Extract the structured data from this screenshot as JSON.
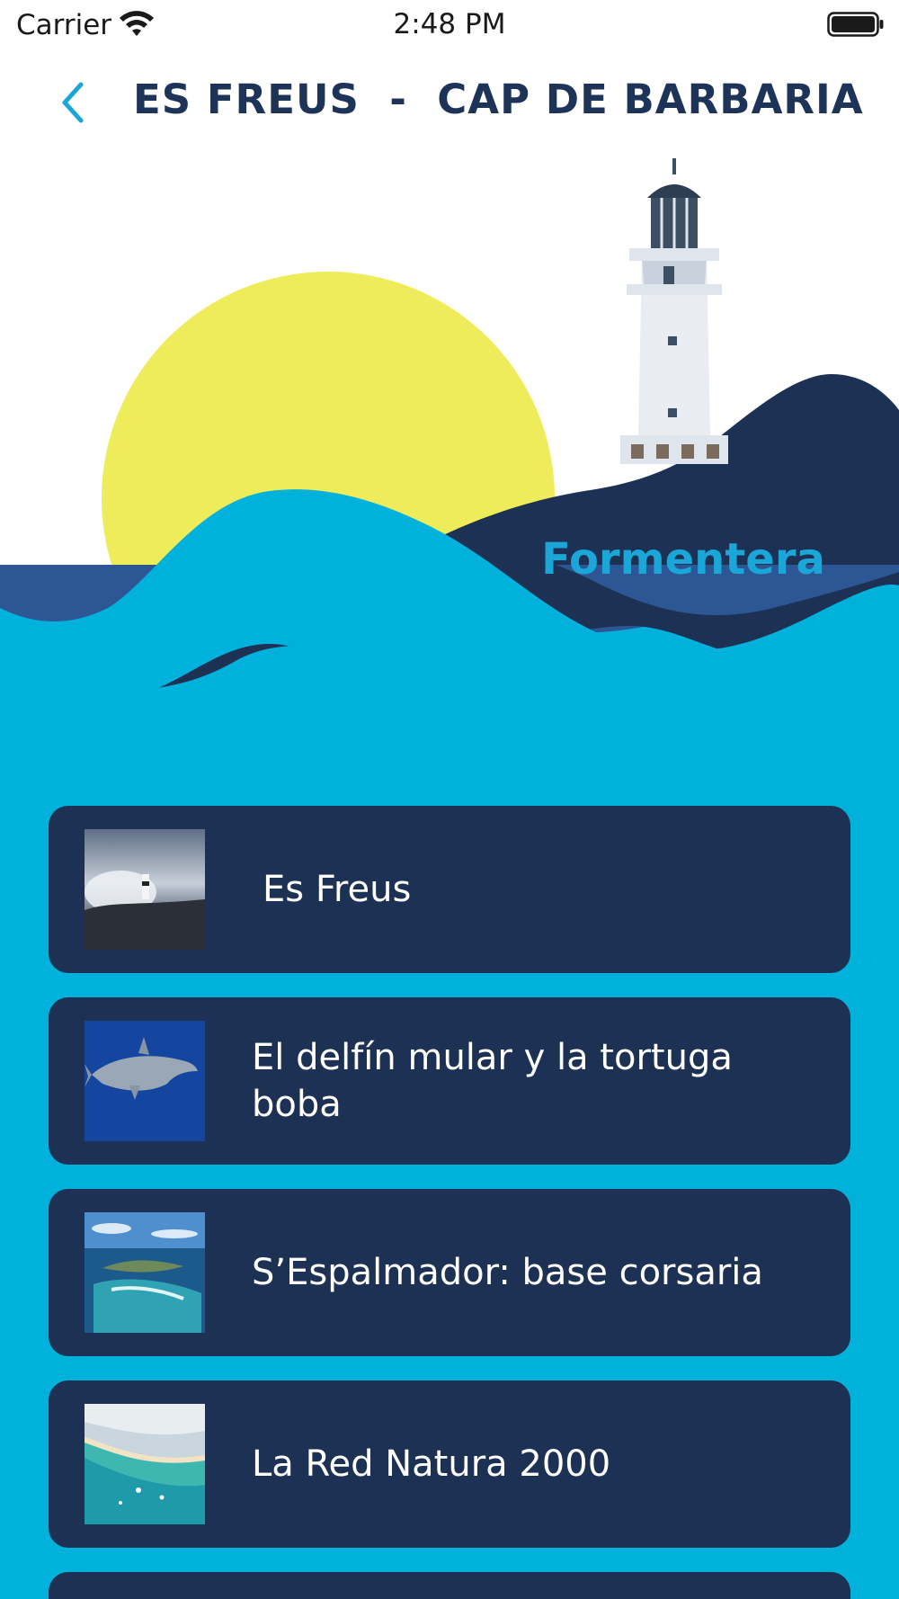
{
  "status_bar": {
    "carrier": "Carrier",
    "time": "2:48 PM"
  },
  "header": {
    "title": "ES FREUS  -  CAP DE BARBARIA",
    "back_icon": "chevron-left-icon"
  },
  "hero": {
    "caption": "Formentera"
  },
  "items": [
    {
      "label": "Es Freus",
      "thumb": "lighthouse-storm-photo"
    },
    {
      "label": "El delfín mular y la tortuga boba",
      "thumb": "dolphin-photo"
    },
    {
      "label": "S’Espalmador: base corsaria",
      "thumb": "island-aerial-photo"
    },
    {
      "label": "La Red Natura 2000",
      "thumb": "beach-aerial-photo"
    }
  ],
  "colors": {
    "navy": "#1c3153",
    "title": "#1e3358",
    "cyan": "#00b2db",
    "sun": "#efec5c",
    "accent": "#1aa6d6"
  }
}
